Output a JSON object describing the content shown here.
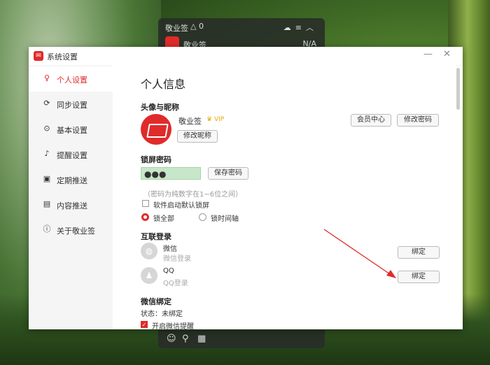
{
  "widget": {
    "title": "敬业签",
    "bell_count": "0",
    "row_text": "敬业签",
    "row_right": "N/A"
  },
  "dialog": {
    "title": "系统设置"
  },
  "sidebar": {
    "items": [
      {
        "label": "个人设置",
        "icon": "user-icon",
        "glyph": "♀"
      },
      {
        "label": "同步设置",
        "icon": "sync-icon",
        "glyph": "⟳"
      },
      {
        "label": "基本设置",
        "icon": "settings-icon",
        "glyph": "⊙"
      },
      {
        "label": "提醒设置",
        "icon": "bell-icon",
        "glyph": "♪"
      },
      {
        "label": "定期推送",
        "icon": "calendar-icon",
        "glyph": "▣"
      },
      {
        "label": "内容推送",
        "icon": "content-icon",
        "glyph": "▤"
      },
      {
        "label": "关于敬业签",
        "icon": "info-icon",
        "glyph": "ⓘ"
      }
    ]
  },
  "main": {
    "heading": "个人信息",
    "avatar_section": "头像与昵称",
    "nickname": "敬业签",
    "vip_badge": "VIP",
    "edit_nick_btn": "修改昵称",
    "member_btn": "会员中心",
    "change_pwd_btn": "修改密码",
    "lock_section": "锁屏密码",
    "pwd_value": "●●●",
    "save_pwd_btn": "保存密码",
    "pwd_hint": "（密码为纯数字在1~6位之间）",
    "default_lock_label": "软件启动默认锁屏",
    "lock_all_label": "锁全部",
    "lock_timeline_label": "锁时间轴",
    "social_section": "互联登录",
    "wechat_name": "微信",
    "wechat_sub": "微信登录",
    "qq_name": "QQ",
    "qq_sub": "QQ登录",
    "bind_btn_1": "绑定",
    "bind_btn_2": "绑定",
    "wechat_bind_section": "微信绑定",
    "bind_status": "状态：未绑定",
    "wechat_remind_label": "开启微信提醒"
  },
  "colors": {
    "accent": "#e02b2b",
    "input_bg": "#c8e6c9"
  }
}
